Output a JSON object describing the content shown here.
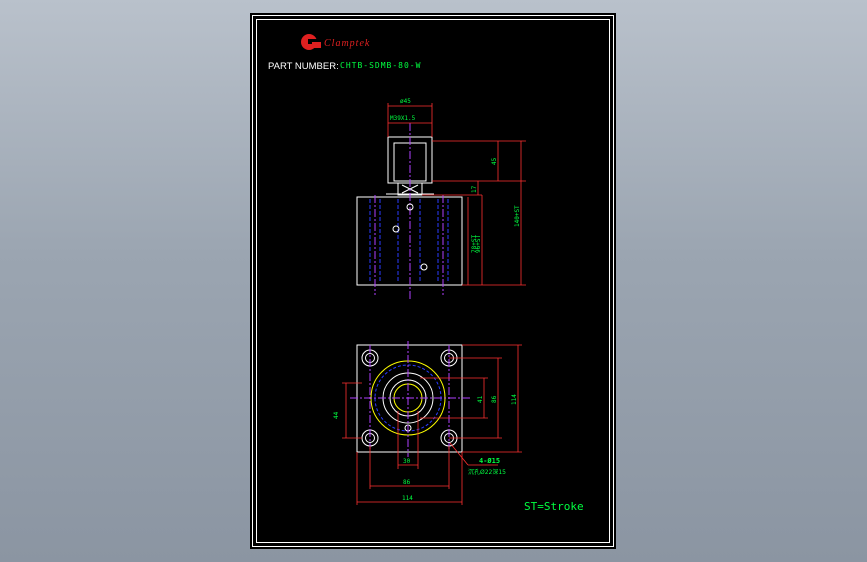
{
  "colors": {
    "background": "#000000",
    "frame": "#ffffff",
    "part": "#ffffff",
    "dimension": "#ff3030",
    "dimension_text": "#00ff40",
    "center_line": "#b040ff",
    "hidden_line": "#2a3cff",
    "logo": "#e02020",
    "yellow": "#ffff00"
  },
  "header": {
    "logo_text": "Clamptek",
    "part_number_label": "PART NUMBER:",
    "part_number_value": "CHTB-SDMB-80-W"
  },
  "dimensions": {
    "top_dia": "ø45",
    "thread": "M39X1.5",
    "d_45": "45",
    "d_17": "17",
    "d_78st": "78+ST",
    "d_96st": "96+ST",
    "d_140st": "140+ST",
    "d_44": "44",
    "d_41": "41",
    "d_86v": "86",
    "d_114v": "114",
    "d_30": "30",
    "d_86h": "86",
    "d_114h": "114",
    "holes": "4-Ø15",
    "counterbore": "沉孔Ø22深15"
  },
  "note": "ST=Stroke"
}
